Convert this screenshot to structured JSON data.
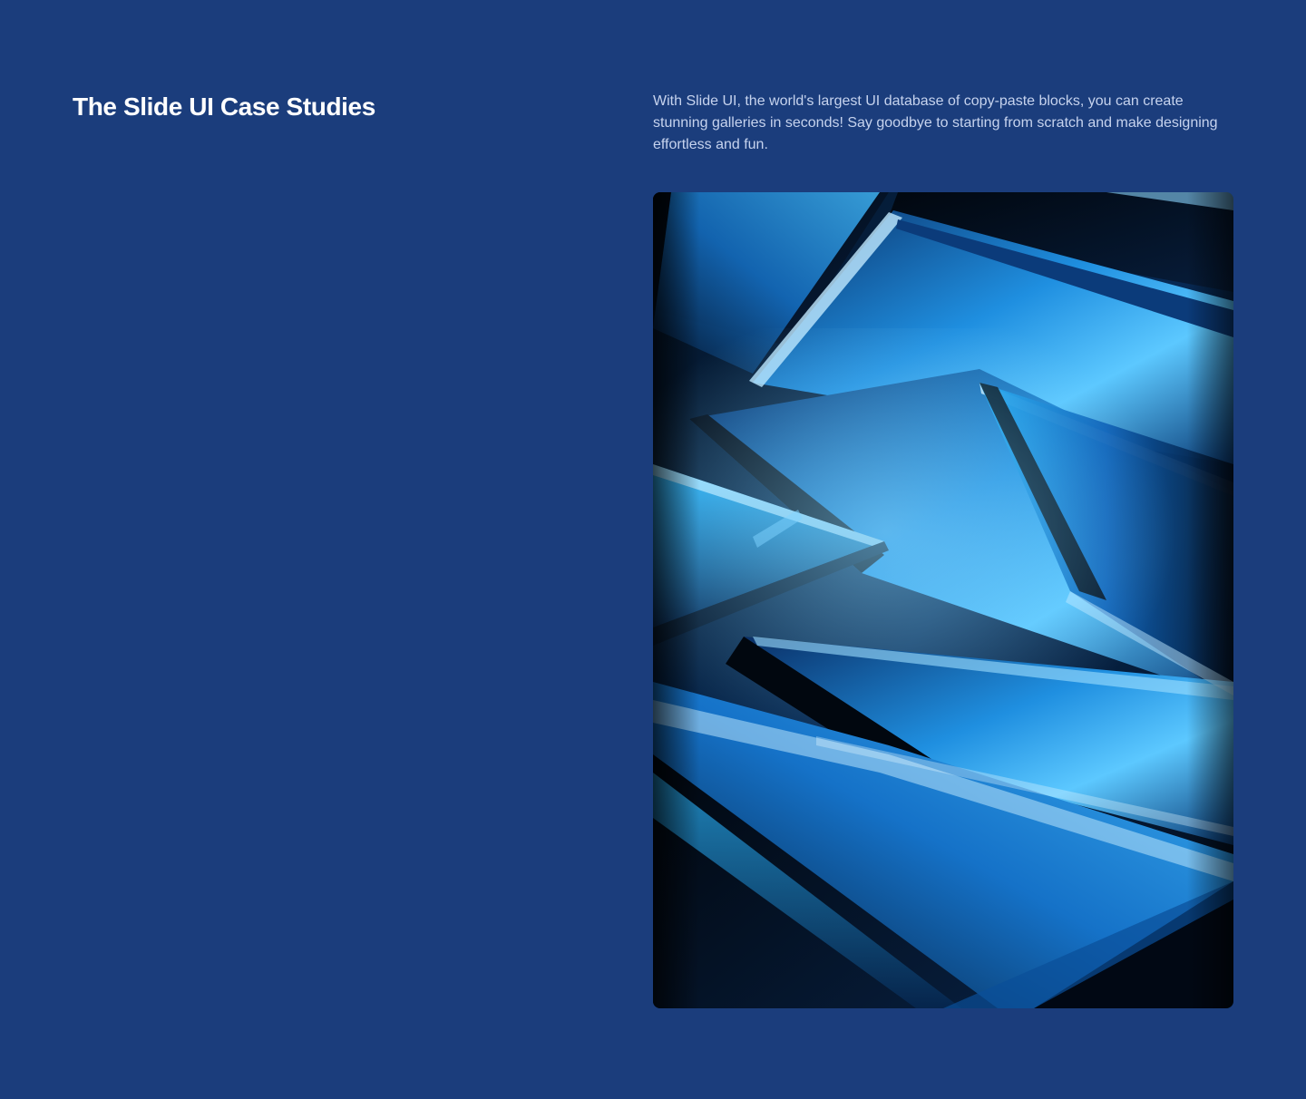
{
  "colors": {
    "background": "#1b3d7c",
    "title": "#ffffff",
    "description": "#c6d3ee"
  },
  "section": {
    "title": "The Slide UI Case Studies",
    "description": "With Slide UI, the world's largest UI database of copy-paste blocks, you can create stunning galleries in seconds! Say goodbye to starting from scratch and make designing effortless and fun."
  },
  "gallery_image": {
    "subject": "abstract blue glass shards"
  }
}
